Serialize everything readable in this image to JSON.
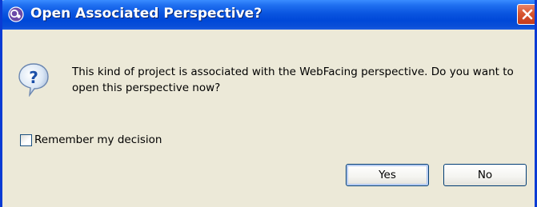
{
  "window": {
    "title": "Open Associated Perspective?",
    "app_icon": "eclipse-perspective-icon",
    "close_icon": "close-icon"
  },
  "dialog": {
    "icon": "question-icon",
    "message": "This kind of project is associated with the WebFacing perspective.  Do you want to open this perspective now?",
    "remember_label": "Remember my decision",
    "remember_checked": false
  },
  "buttons": {
    "yes_label": "Yes",
    "no_label": "No"
  },
  "colors": {
    "titlebar": "#0a55e0",
    "dialog_bg": "#ece9d8",
    "close_button": "#d8552f"
  }
}
